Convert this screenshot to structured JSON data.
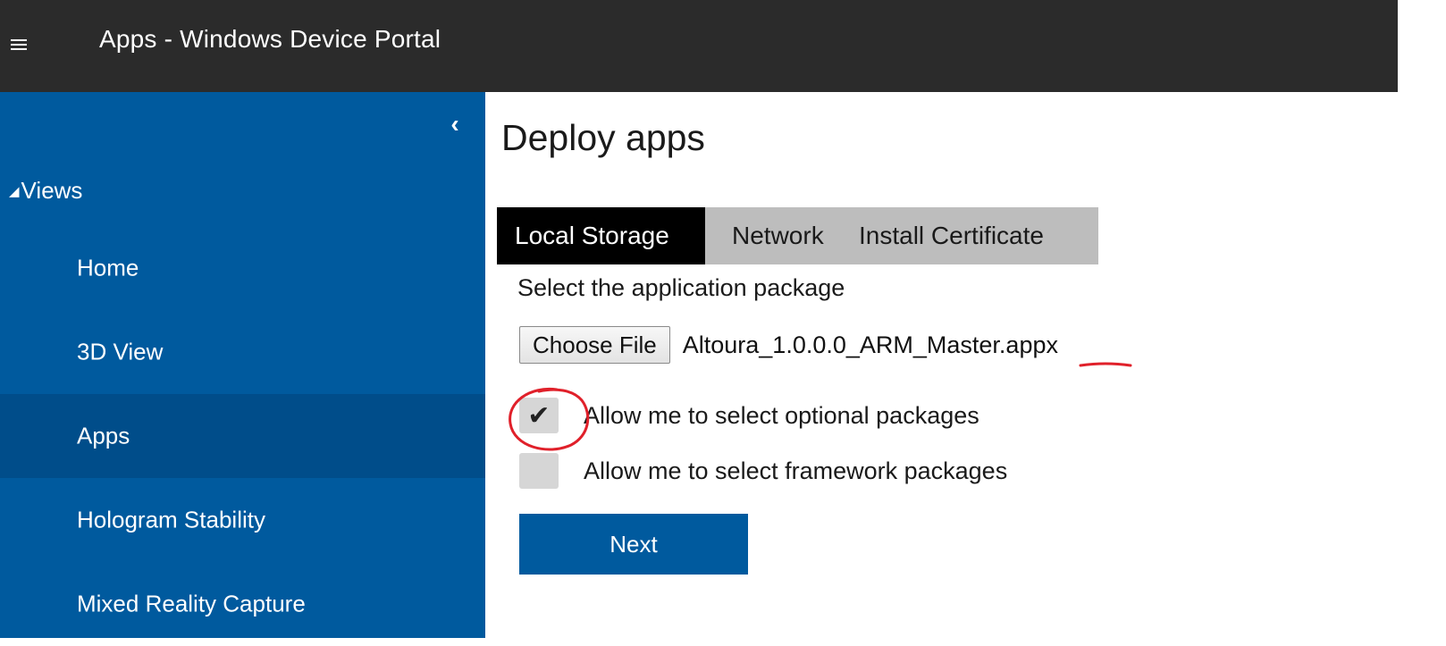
{
  "header": {
    "title": "Apps - Windows Device Portal",
    "menu_icon": "hamburger-menu-icon"
  },
  "sidebar": {
    "collapse_icon": "chevron-left-icon",
    "section_label": "Views",
    "items": [
      {
        "label": "Home"
      },
      {
        "label": "3D View"
      },
      {
        "label": "Apps",
        "active": true
      },
      {
        "label": "Hologram Stability"
      },
      {
        "label": "Mixed Reality Capture"
      }
    ],
    "colors": {
      "background": "#005a9e",
      "active": "#004d8a"
    }
  },
  "main": {
    "title": "Deploy apps",
    "tabs": [
      {
        "label": "Local Storage",
        "active": true
      },
      {
        "label": "Network"
      },
      {
        "label": "Install Certificate"
      }
    ],
    "select_label": "Select the application package",
    "file_input": {
      "button_label": "Choose File",
      "file_name": "Altoura_1.0.0.0_ARM_Master.appx"
    },
    "options": [
      {
        "label": "Allow me to select optional packages",
        "checked": true
      },
      {
        "label": "Allow me to select framework packages",
        "checked": false
      }
    ],
    "next_label": "Next"
  },
  "annotation_color": "#e0202a"
}
